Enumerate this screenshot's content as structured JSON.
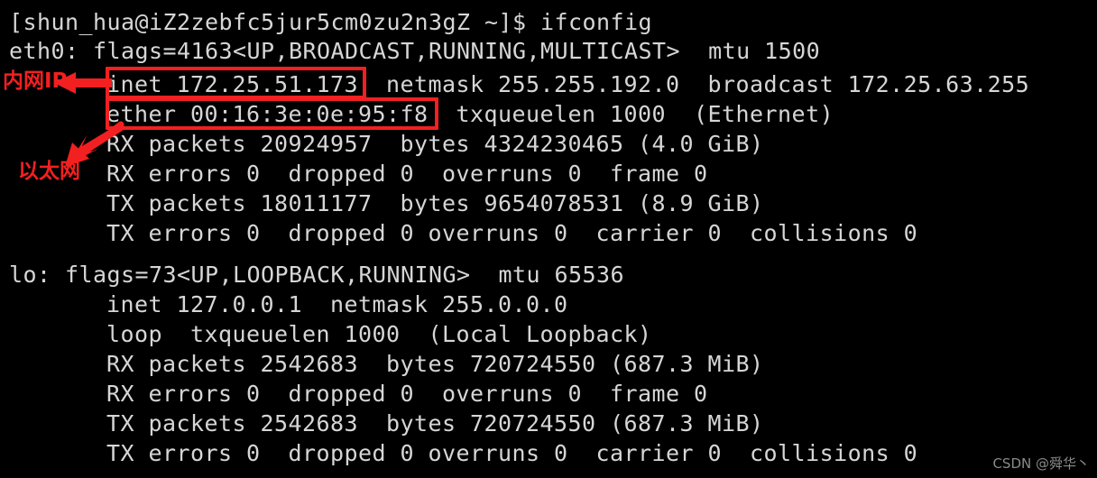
{
  "terminal": {
    "prompt_line": "[shun_hua@iZ2zebfc5jur5cm0zu2n3gZ ~]$ ifconfig",
    "lines": [
      {
        "text": "eth0: flags=4163<UP,BROADCAST,RUNNING,MULTICAST>  mtu 1500",
        "indent": false
      },
      {
        "text": "inet 172.25.51.173  netmask 255.255.192.0  broadcast 172.25.63.255",
        "indent": true
      },
      {
        "text": "ether 00:16:3e:0e:95:f8  txqueuelen 1000  (Ethernet)",
        "indent": true
      },
      {
        "text": "RX packets 20924957  bytes 4324230465 (4.0 GiB)",
        "indent": true
      },
      {
        "text": "RX errors 0  dropped 0  overruns 0  frame 0",
        "indent": true
      },
      {
        "text": "TX packets 18011177  bytes 9654078531 (8.9 GiB)",
        "indent": true
      },
      {
        "text": "TX errors 0  dropped 0 overruns 0  carrier 0  collisions 0",
        "indent": true
      },
      {
        "text": "",
        "indent": false
      },
      {
        "text": "lo: flags=73<UP,LOOPBACK,RUNNING>  mtu 65536",
        "indent": false
      },
      {
        "text": "inet 127.0.0.1  netmask 255.0.0.0",
        "indent": true
      },
      {
        "text": "loop  txqueuelen 1000  (Local Loopback)",
        "indent": true
      },
      {
        "text": "RX packets 2542683  bytes 720724550 (687.3 MiB)",
        "indent": true
      },
      {
        "text": "RX errors 0  dropped 0  overruns 0  frame 0",
        "indent": true
      },
      {
        "text": "TX packets 2542683  bytes 720724550 (687.3 MiB)",
        "indent": true
      },
      {
        "text": "TX errors 0  dropped 0 overruns 0  carrier 0  collisions 0",
        "indent": true
      }
    ]
  },
  "interfaces": {
    "eth0": {
      "name": "eth0",
      "flags": "4163<UP,BROADCAST,RUNNING,MULTICAST>",
      "mtu": "1500",
      "inet": "172.25.51.173",
      "netmask": "255.255.192.0",
      "broadcast": "172.25.63.255",
      "ether": "00:16:3e:0e:95:f8",
      "txqueuelen": "1000",
      "type": "(Ethernet)",
      "rx_packets": "20924957",
      "rx_bytes": "4324230465",
      "rx_bytes_human": "(4.0 GiB)",
      "rx_errors": "0",
      "rx_dropped": "0",
      "rx_overruns": "0",
      "rx_frame": "0",
      "tx_packets": "18011177",
      "tx_bytes": "9654078531",
      "tx_bytes_human": "(8.9 GiB)",
      "tx_errors": "0",
      "tx_dropped": "0",
      "tx_overruns": "0",
      "tx_carrier": "0",
      "tx_collisions": "0"
    },
    "lo": {
      "name": "lo",
      "flags": "73<UP,LOOPBACK,RUNNING>",
      "mtu": "65536",
      "inet": "127.0.0.1",
      "netmask": "255.0.0.0",
      "loop": "loop",
      "txqueuelen": "1000",
      "type": "(Local Loopback)",
      "rx_packets": "2542683",
      "rx_bytes": "720724550",
      "rx_bytes_human": "(687.3 MiB)",
      "rx_errors": "0",
      "rx_dropped": "0",
      "rx_overruns": "0",
      "rx_frame": "0",
      "tx_packets": "2542683",
      "tx_bytes": "720724550",
      "tx_bytes_human": "(687.3 MiB)",
      "tx_errors": "0",
      "tx_dropped": "0",
      "tx_overruns": "0",
      "tx_carrier": "0",
      "tx_collisions": "0"
    }
  },
  "annotations": {
    "color": "#f22020",
    "internal_ip_label": "内网IP",
    "ethernet_label": "以太网"
  },
  "watermark": {
    "text": "CSDN @舜华丶"
  },
  "colors": {
    "background": "#000000",
    "text": "#d6d6d6",
    "annotation": "#f22020",
    "watermark": "#8a8a8a"
  }
}
